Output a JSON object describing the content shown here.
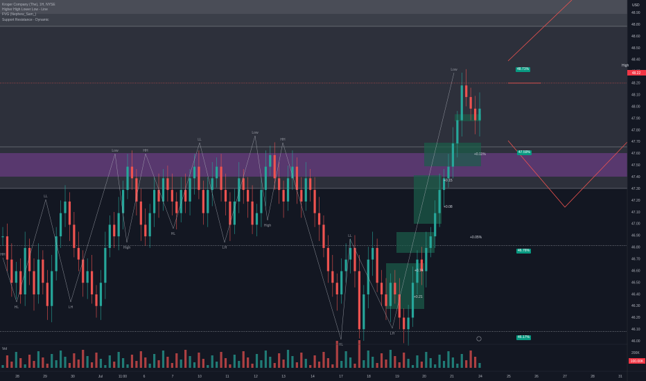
{
  "legend": [
    "Kroger Company (The), 1H, NYSE",
    "Higher High Lower Low - Line",
    "FVG (Nephew_Sam_)",
    "Support Resistance - Dynamic"
  ],
  "currency": "USD",
  "price_axis": [
    "48.90",
    "48.80",
    "48.60",
    "48.50",
    "48.40",
    "48.25",
    "48.20",
    "48.10",
    "48.00",
    "47.90",
    "47.80",
    "47.70",
    "47.60",
    "47.50",
    "47.40",
    "47.30",
    "47.20",
    "47.10",
    "47.00",
    "46.90",
    "46.80",
    "46.70",
    "46.60",
    "46.50",
    "46.40",
    "46.30",
    "46.20",
    "46.10",
    "46.00"
  ],
  "time_axis": [
    "28",
    "29",
    "30",
    "Jul",
    "11:00",
    "6",
    "7",
    "10",
    "11",
    "12",
    "13",
    "14",
    "17",
    "18",
    "19",
    "20",
    "21",
    "24",
    "25",
    "26",
    "27",
    "28",
    "31"
  ],
  "volume_label": "Vol",
  "volume_axis": [
    "200K",
    "100.00K"
  ],
  "high_tag": "High",
  "price_badge": "48.22",
  "pills": [
    "48.71%",
    "47.59%",
    "46.76%",
    "46.17%"
  ],
  "swing_labels": [
    "HH",
    "HL",
    "LL",
    "LH",
    "Low",
    "High"
  ],
  "box_labels": [
    "+0.74",
    "+0.21",
    "+0.15",
    "+0.08",
    "+0.11%",
    "+0.05%"
  ],
  "colors": {
    "background": "#131722",
    "up": "#26a69a",
    "down": "#ef5350",
    "purple_zone": "#7b3f99",
    "green_zone": "#1b5e4a",
    "grey_zone": "#434651"
  },
  "chart_data": {
    "type": "candlestick",
    "title": "Kroger Company (The), 1H, NYSE",
    "y_range": [
      46.0,
      48.9
    ],
    "high_line": 48.22,
    "support_line": 46.82,
    "low_line": 46.08,
    "closes": [
      46.9,
      46.7,
      46.5,
      46.6,
      46.4,
      46.8,
      46.6,
      46.4,
      46.7,
      46.5,
      46.3,
      46.6,
      46.9,
      47.1,
      47.2,
      47.0,
      46.8,
      46.7,
      46.5,
      46.6,
      46.4,
      46.3,
      46.5,
      46.8,
      47.0,
      46.9,
      47.1,
      47.3,
      47.5,
      47.4,
      47.2,
      47.0,
      46.9,
      47.1,
      47.3,
      47.2,
      47.4,
      47.3,
      47.2,
      47.1,
      47.3,
      47.2,
      47.4,
      47.5,
      47.3,
      47.1,
      47.3,
      47.4,
      47.5,
      47.3,
      47.2,
      47.0,
      47.2,
      47.4,
      47.3,
      47.2,
      47.0,
      47.1,
      47.3,
      47.5,
      47.6,
      47.4,
      47.3,
      47.2,
      47.4,
      47.5,
      47.3,
      47.2,
      47.4,
      47.3,
      47.1,
      47.0,
      46.8,
      46.6,
      46.5,
      46.4,
      46.6,
      46.7,
      46.8,
      46.6,
      46.1,
      46.4,
      46.7,
      46.8,
      46.5,
      46.4,
      46.3,
      46.5,
      46.4,
      46.2,
      46.1,
      46.2,
      46.5,
      46.7,
      46.6,
      46.8,
      46.9,
      47.1,
      47.3,
      47.4,
      47.5,
      47.7,
      47.9,
      48.2,
      48.1,
      48.0,
      47.9,
      48.0
    ]
  }
}
